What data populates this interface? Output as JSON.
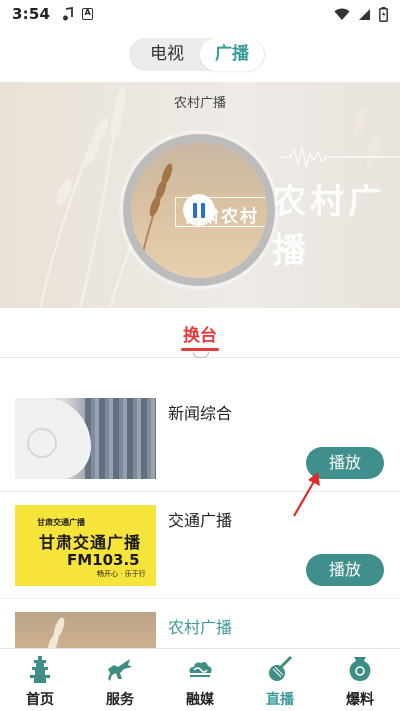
{
  "status_bar": {
    "time": "3:54",
    "notif_icons": [
      "music-note-icon",
      "a-box-icon"
    ],
    "right_icons": [
      "wifi-icon",
      "signal-icon",
      "battery-icon"
    ],
    "a_box_text": "A"
  },
  "toggle": {
    "tv_label": "电视",
    "radio_label": "广播",
    "active": "radio",
    "accent": "#3b9b99"
  },
  "hero": {
    "station_title": "农村广播",
    "art_text": "甘肃农村",
    "bg_text": "农村广播"
  },
  "switch_tab": {
    "label": "换台",
    "color": "#e23b3b"
  },
  "list": {
    "play_label": "播放",
    "button_color": "#3f8f8c",
    "items": [
      {
        "name": "新闻综合"
      },
      {
        "name": "交通广播",
        "thumb_line1": "甘肃交通广播",
        "thumb_line2": "FM103.5",
        "thumb_top": "甘肃交通广播",
        "thumb_tag": "畅开心 · 乐于行"
      },
      {
        "name": "农村广播"
      }
    ]
  },
  "bottom_nav": {
    "items": [
      {
        "label": "首页",
        "icon": "pagoda-icon"
      },
      {
        "label": "服务",
        "icon": "horse-icon"
      },
      {
        "label": "融媒",
        "icon": "cloud-icon"
      },
      {
        "label": "直播",
        "icon": "pipa-icon"
      },
      {
        "label": "爆料",
        "icon": "vase-icon"
      }
    ],
    "active_index": 3
  }
}
